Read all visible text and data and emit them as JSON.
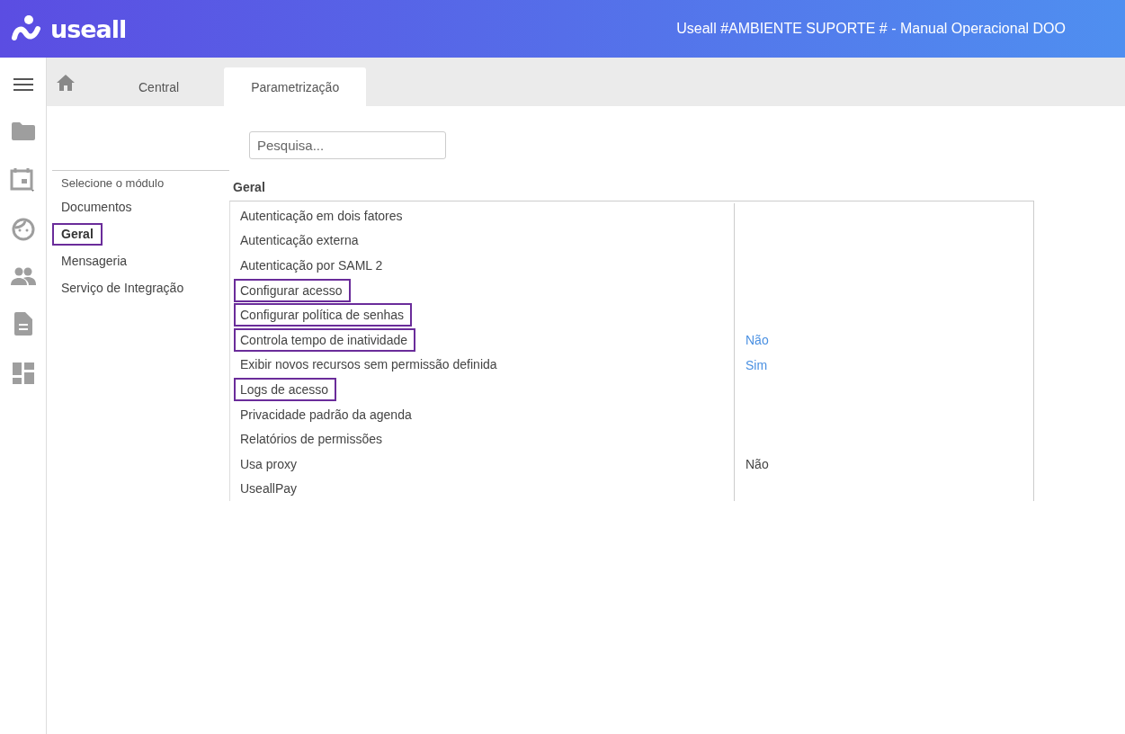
{
  "header": {
    "logo": "useall",
    "title": "Useall #AMBIENTE SUPORTE # - Manual Operacional DOO"
  },
  "tabs": [
    {
      "label": "Central",
      "selected": false
    },
    {
      "label": "Parametrização",
      "selected": true
    }
  ],
  "search": {
    "placeholder": "Pesquisa..."
  },
  "modules": {
    "heading": "Selecione o módulo",
    "items": [
      {
        "label": "Documentos",
        "selected": false,
        "highlighted": false
      },
      {
        "label": "Geral",
        "selected": true,
        "highlighted": true
      },
      {
        "label": "Mensageria",
        "selected": false,
        "highlighted": false
      },
      {
        "label": "Serviço de Integração",
        "selected": false,
        "highlighted": false
      }
    ]
  },
  "section": {
    "title": "Geral",
    "rows": [
      {
        "label": "Autenticação em dois fatores",
        "highlighted": false
      },
      {
        "label": "Autenticação externa",
        "highlighted": false
      },
      {
        "label": "Autenticação por SAML 2",
        "highlighted": false
      },
      {
        "label": "Configurar acesso",
        "highlighted": true
      },
      {
        "label": "Configurar política de senhas",
        "highlighted": true
      },
      {
        "label": "Controla tempo de inatividade",
        "highlighted": true,
        "value": "Não",
        "kind": "link"
      },
      {
        "label": "Exibir novos recursos sem permissão definida",
        "highlighted": false,
        "value": "Sim",
        "kind": "link"
      },
      {
        "label": "Logs de acesso",
        "highlighted": true
      },
      {
        "label": "Privacidade padrão da agenda",
        "highlighted": false
      },
      {
        "label": "Relatórios de permissões",
        "highlighted": false
      },
      {
        "label": "Usa proxy",
        "highlighted": false,
        "value": "Não",
        "kind": "text"
      },
      {
        "label": "UseallPay",
        "highlighted": false
      }
    ]
  }
}
